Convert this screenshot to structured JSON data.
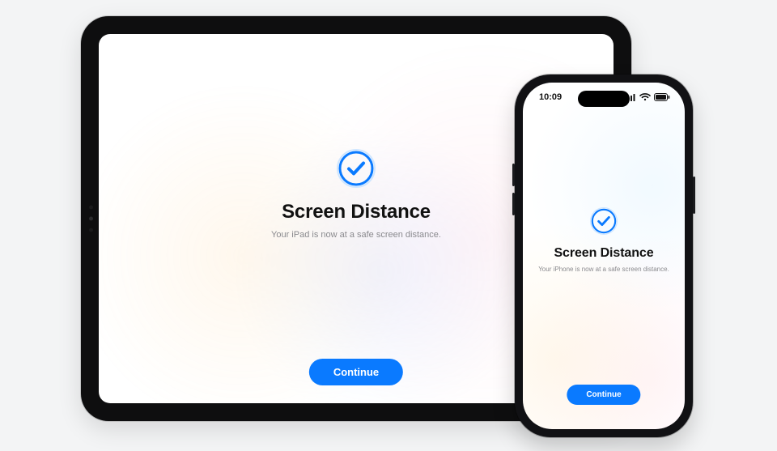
{
  "colors": {
    "accent": "#0a7aff",
    "text_secondary": "#8a8a8e"
  },
  "ipad": {
    "icon_name": "checkmark-circle-icon",
    "title": "Screen Distance",
    "subtitle": "Your iPad is now at a safe screen distance.",
    "continue_label": "Continue"
  },
  "iphone": {
    "status": {
      "time": "10:09",
      "signal_icon": "cellular-signal-icon",
      "wifi_icon": "wifi-icon",
      "battery_icon": "battery-icon"
    },
    "icon_name": "checkmark-circle-icon",
    "title": "Screen Distance",
    "subtitle": "Your iPhone is now at a safe screen distance.",
    "continue_label": "Continue"
  }
}
